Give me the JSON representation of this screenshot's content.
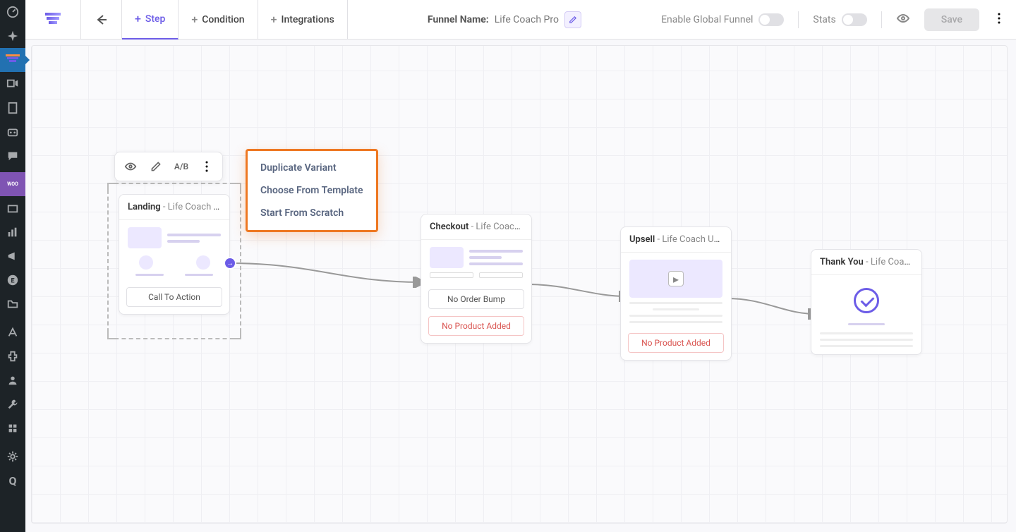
{
  "topbar": {
    "tabs": [
      {
        "label": "Step",
        "active": true
      },
      {
        "label": "Condition",
        "active": false
      },
      {
        "label": "Integrations",
        "active": false
      }
    ],
    "funnel_name_label": "Funnel Name:",
    "funnel_name_value": "Life Coach Pro",
    "enable_global": "Enable Global Funnel",
    "stats": "Stats",
    "save": "Save"
  },
  "toolbar": {
    "ab": "A/B"
  },
  "dropdown": [
    "Duplicate Variant",
    "Choose From Template",
    "Start From Scratch"
  ],
  "nodes": {
    "landing": {
      "type": "Landing",
      "sub": " - Life Coach Lan...",
      "cta": "Call To Action"
    },
    "checkout": {
      "type": "Checkout",
      "sub": " - Life Coach Ch...",
      "bump": "No Order Bump",
      "warn": "No Product Added"
    },
    "upsell": {
      "type": "Upsell",
      "sub": " - Life Coach Up...",
      "warn": "No Product Added"
    },
    "thankyou": {
      "type": "Thank You",
      "sub": " - Life Coach Tha..."
    }
  }
}
